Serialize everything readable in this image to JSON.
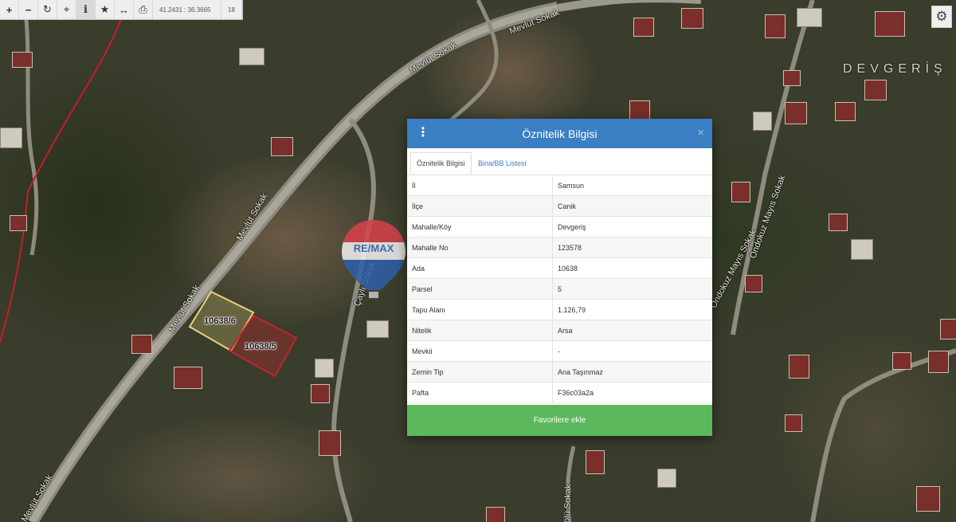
{
  "toolbar": {
    "buttons": [
      {
        "name": "zoom-in",
        "glyph": "+"
      },
      {
        "name": "zoom-out",
        "glyph": "−"
      },
      {
        "name": "refresh",
        "glyph": "↻"
      },
      {
        "name": "locate",
        "glyph": "⌖"
      },
      {
        "name": "info",
        "glyph": "i"
      },
      {
        "name": "favorite",
        "glyph": "★"
      },
      {
        "name": "measure",
        "glyph": "↔"
      },
      {
        "name": "print",
        "glyph": "⎙"
      }
    ],
    "coordinates": "41.2431 : 36.3665",
    "zoom_level": "18"
  },
  "map": {
    "road_labels": [
      "Mevlüt Sokak",
      "Mevlüt Sokak",
      "Mevlüt Sokak",
      "Mevlüt Sokak",
      "Mevlüt Sokak",
      "Çaylı Sokak",
      "Ondokuz Mayıs Sokak",
      "Ondokuz Mayıs Sokak",
      "ölü Sokak"
    ],
    "district_label": "DEVGERİŞ",
    "parcel_labels": [
      "10638/6",
      "10638/5"
    ],
    "colors": {
      "parcel_6": "#e8d27a",
      "parcel_5": "#c0242c",
      "boundary": "#c41e24"
    }
  },
  "watermark": {
    "text": "RE/MAX",
    "balloon_text": "RE/MAX",
    "color": "#e35460",
    "slash_color": "#2f5fa8"
  },
  "modal": {
    "title": "Öznitelik Bilgisi",
    "close_glyph": "×",
    "menu_glyph": "⋮",
    "tabs": [
      "Öznitelik Bilgisi",
      "Bina/BB Listesi"
    ],
    "rows": [
      {
        "key": "İl",
        "value": "Samsun"
      },
      {
        "key": "İlçe",
        "value": "Canik"
      },
      {
        "key": "Mahalle/Köy",
        "value": "Devgeriş"
      },
      {
        "key": "Mahalle No",
        "value": "123578"
      },
      {
        "key": "Ada",
        "value": "10638"
      },
      {
        "key": "Parsel",
        "value": "5"
      },
      {
        "key": "Tapu Alanı",
        "value": "1.126,79"
      },
      {
        "key": "Nitelik",
        "value": "Arsa"
      },
      {
        "key": "Mevkii",
        "value": "-"
      },
      {
        "key": "Zemin Tip",
        "value": "Ana Taşınmaz"
      },
      {
        "key": "Pafta",
        "value": "F36c03a2a"
      }
    ],
    "favorite_button": "Favorilere ekle",
    "header_color": "#3a7ec3",
    "button_color": "#5cb85c"
  },
  "settings_icon": "gear-icon"
}
